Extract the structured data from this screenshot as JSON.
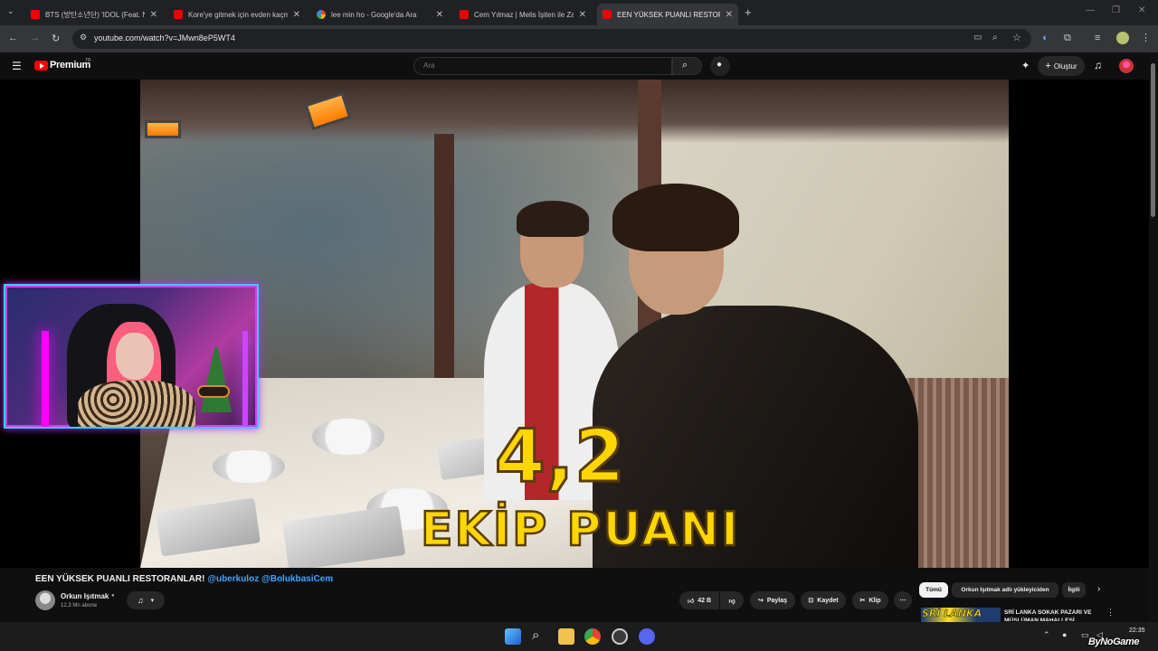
{
  "browser": {
    "tabs": [
      {
        "title": "BTS (방탄소년단) 'IDOL (Feat. N",
        "icon": "youtube-icon"
      },
      {
        "title": "Kore'ye gitmek için evden kaçm",
        "icon": "youtube-icon"
      },
      {
        "title": "lee min ho - Google'da Ara",
        "icon": "google-icon"
      },
      {
        "title": "Cem Yılmaz | Melis İşiten ile Za",
        "icon": "youtube-icon"
      },
      {
        "title": "EEN YÜKSEK PUANLI RESTORAN",
        "icon": "youtube-icon",
        "active": true
      }
    ],
    "new_tab_glyph": "+",
    "url": "youtube.com/watch?v=JMwn8eP5WT4"
  },
  "youtube": {
    "brand": "Premium",
    "region": "TR",
    "search_placeholder": "Ara",
    "create_label": "Oluştur"
  },
  "video": {
    "overlay_score": "4,2",
    "overlay_label": "EKİP PUANI",
    "title_main": "EEN YÜKSEK PUANLI RESTORANLAR!",
    "title_tags": "@uberkuloz @BolukbasiCem"
  },
  "channel": {
    "name": "Orkun Işıtmak",
    "subscribers": "12,3 Mn abone"
  },
  "actions": {
    "like_count": "42 B",
    "share": "Paylaş",
    "save": "Kaydet",
    "clip": "Klip"
  },
  "chips": [
    "Tümü",
    "Orkun Işıtmak adlı yükleyiciden",
    "İlgili"
  ],
  "recommendation": {
    "thumb_text": "SRİ LANKA",
    "title": "SRİ LANKA SOKAK PAZARI VE MÜSLÜMAN MAHALLESİ..."
  },
  "taskbar": {
    "time": "22:35"
  },
  "watermark": "ByNoGame",
  "colors": {
    "accent_link": "#3ea6ff",
    "yt_red": "#ff0000",
    "overlay_yellow": "#ffd600",
    "webcam_border": "#2ad3ff"
  }
}
